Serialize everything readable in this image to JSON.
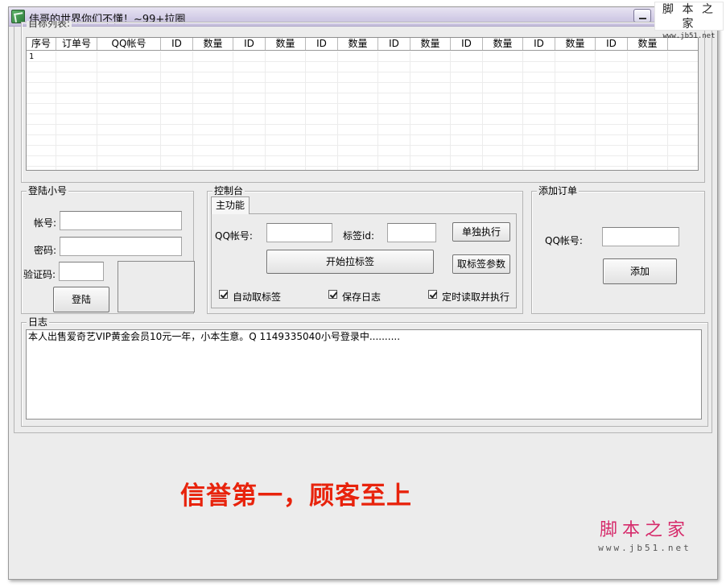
{
  "window": {
    "title": "伟哥的世界你们不懂！~99+拉圈",
    "icon": "app-icon"
  },
  "watermark_top": {
    "text": "脚 本 之 家",
    "url": "www.jb51.net"
  },
  "target_list": {
    "legend": "目标列表:",
    "columns": [
      "序号",
      "订单号",
      "QQ帐号",
      "ID",
      "数量",
      "ID",
      "数量",
      "ID",
      "数量",
      "ID",
      "数量",
      "ID",
      "数量",
      "ID",
      "数量",
      "ID",
      "数量"
    ],
    "rows": [
      [
        "1"
      ]
    ]
  },
  "login": {
    "legend": "登陆小号",
    "account_label": "帐号:",
    "password_label": "密码:",
    "captcha_label": "验证码:",
    "login_button": "登陆"
  },
  "console": {
    "legend": "控制台",
    "tab": "主功能",
    "qq_label": "QQ帐号:",
    "tag_id_label": "标签id:",
    "run_single_button": "单独执行",
    "start_button": "开始拉标签",
    "fetch_params_button": "取标签参数",
    "checkboxes": [
      {
        "label": "自动取标签",
        "checked": true
      },
      {
        "label": "保存日志",
        "checked": true
      },
      {
        "label": "定时读取并执行",
        "checked": true
      }
    ]
  },
  "add_order": {
    "legend": "添加订单",
    "qq_label": "QQ帐号:",
    "add_button": "添加"
  },
  "log": {
    "legend": "日志",
    "lines": [
      "本人出售爱奇艺VIP黄金会员10元一年，小本生意。Q 1149335040小号登录中.........."
    ]
  },
  "slogan": "信誉第一，顾客至上",
  "watermark_bottom": {
    "text": "脚本之家",
    "url": "www.jb51.net"
  },
  "colors": {
    "slogan": "#e8230c",
    "titlebar": "#d2cce6",
    "window_bg": "#ececec"
  }
}
